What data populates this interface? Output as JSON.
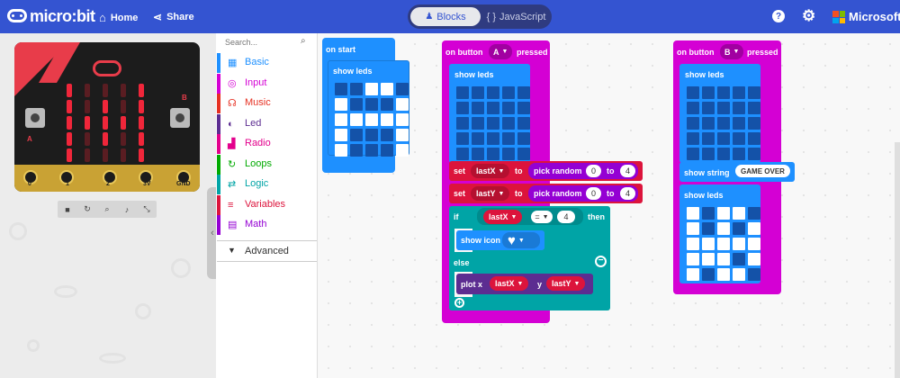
{
  "topbar": {
    "logo": "micro:bit",
    "home": "Home",
    "share": "Share",
    "tab_blocks": "Blocks",
    "tab_js": "JavaScript",
    "help_icon": "help",
    "settings_icon": "settings",
    "brand": "Microsoft"
  },
  "simulator": {
    "pins": [
      "0",
      "1",
      "2",
      "3V",
      "GND"
    ],
    "button_a": "A",
    "button_b": "B",
    "controls": [
      "stop",
      "restart",
      "slowmo",
      "sound",
      "fullscreen"
    ],
    "leds": [
      [
        1,
        0,
        0,
        0,
        1
      ],
      [
        1,
        0,
        1,
        0,
        1
      ],
      [
        1,
        1,
        1,
        1,
        1
      ],
      [
        1,
        0,
        1,
        0,
        1
      ],
      [
        1,
        0,
        0,
        0,
        1
      ]
    ]
  },
  "toolbox": {
    "search_placeholder": "Search...",
    "categories": [
      {
        "label": "Basic",
        "color": "#1e90ff",
        "icon": "grid-icon"
      },
      {
        "label": "Input",
        "color": "#d400d4",
        "icon": "target-icon"
      },
      {
        "label": "Music",
        "color": "#e63022",
        "icon": "headphones-icon"
      },
      {
        "label": "Led",
        "color": "#5c2d91",
        "icon": "toggle-icon"
      },
      {
        "label": "Radio",
        "color": "#e3008c",
        "icon": "signal-icon"
      },
      {
        "label": "Loops",
        "color": "#00aa00",
        "icon": "loop-icon"
      },
      {
        "label": "Logic",
        "color": "#00a4a6",
        "icon": "shuffle-icon"
      },
      {
        "label": "Variables",
        "color": "#dc143c",
        "icon": "list-icon"
      },
      {
        "label": "Math",
        "color": "#9400d3",
        "icon": "calculator-icon"
      }
    ],
    "advanced": "Advanced"
  },
  "blocks": {
    "on_start": {
      "hat": "on start",
      "show_leds": "show leds",
      "leds": [
        [
          0,
          0,
          1,
          1,
          0
        ],
        [
          1,
          0,
          0,
          0,
          1
        ],
        [
          1,
          1,
          1,
          1,
          1
        ],
        [
          1,
          0,
          0,
          0,
          1
        ],
        [
          1,
          0,
          0,
          0,
          1
        ]
      ]
    },
    "button_a": {
      "prefix": "on button",
      "button": "A",
      "suffix": "pressed",
      "show_leds": "show leds",
      "leds": [
        [
          0,
          0,
          0,
          0,
          0
        ],
        [
          0,
          0,
          0,
          0,
          0
        ],
        [
          0,
          0,
          0,
          0,
          0
        ],
        [
          0,
          0,
          0,
          0,
          0
        ],
        [
          0,
          0,
          0,
          0,
          0
        ]
      ],
      "set": "set",
      "var_x": "lastX",
      "var_y": "lastY",
      "to": "to",
      "pick_random": "pick random",
      "min": "0",
      "max_to": "to",
      "max": "4",
      "if": "if",
      "eq": "=",
      "cmp": "4",
      "then": "then",
      "show_icon": "show icon",
      "else": "else",
      "plot": "plot x",
      "y": "y"
    },
    "button_b": {
      "prefix": "on button",
      "button": "B",
      "suffix": "pressed",
      "show_leds": "show leds",
      "leds": [
        [
          0,
          0,
          0,
          0,
          0
        ],
        [
          0,
          0,
          0,
          0,
          0
        ],
        [
          0,
          0,
          0,
          0,
          0
        ],
        [
          0,
          0,
          0,
          0,
          0
        ],
        [
          0,
          0,
          0,
          0,
          0
        ]
      ],
      "show_string": "show string",
      "string": "GAME OVER",
      "show_leds2": "show leds",
      "leds2": [
        [
          1,
          0,
          1,
          1,
          0
        ],
        [
          1,
          0,
          1,
          0,
          1
        ],
        [
          1,
          1,
          1,
          1,
          1
        ],
        [
          1,
          1,
          1,
          0,
          1
        ],
        [
          1,
          0,
          1,
          1,
          0
        ]
      ]
    }
  },
  "colors": {
    "topbar": "#3454d1",
    "basic": "#1e90ff",
    "input": "#d400d4",
    "variables": "#dc143c",
    "logic": "#00a4a6",
    "led": "#5c2d91"
  }
}
